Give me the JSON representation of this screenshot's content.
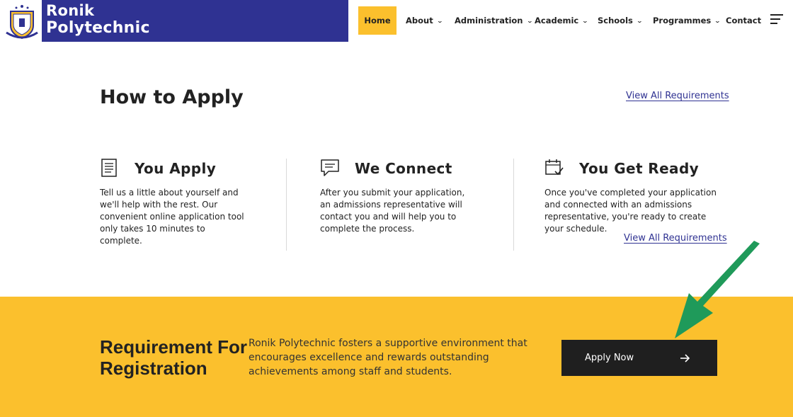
{
  "header": {
    "brand_line1": "Ronik",
    "brand_line2": "Polytechnic",
    "logo_icon": "school-crest-icon",
    "brand_color": "#2f3292",
    "nav": {
      "home": "Home",
      "about": "About",
      "administration": "Administration",
      "academic": "Academic",
      "schools": "Schools",
      "programmes": "Programmes",
      "contact": "Contact"
    },
    "menu_icon": "hamburger-menu-icon"
  },
  "how_to_apply": {
    "title": "How to Apply",
    "view_all_top": "View All Requirements",
    "view_all_bottom": "View All Requirements",
    "steps": [
      {
        "icon": "document-icon",
        "title": "You Apply",
        "text": "Tell us a little about yourself and we'll help with the rest. Our convenient online application tool only takes 10 minutes to complete."
      },
      {
        "icon": "chat-bubble-icon",
        "title": "We Connect",
        "text": "After you submit your application, an admissions representative will contact you and will help you to complete the process."
      },
      {
        "icon": "calendar-check-icon",
        "title": "You Get Ready",
        "text": "Once you've completed your application and connected with an admissions representative, you're ready to create your schedule."
      }
    ]
  },
  "registration": {
    "title": "Requirement For Registration",
    "text": "Ronik Polytechnic fosters a supportive environment that encourages excellence and rewards outstanding achievements among staff and students.",
    "button_label": "Apply Now",
    "button_icon": "arrow-right-icon",
    "accent_color": "#fbc02d",
    "annotation_icon": "green-pointer-arrow-icon",
    "annotation_color": "#1f9a5a"
  }
}
